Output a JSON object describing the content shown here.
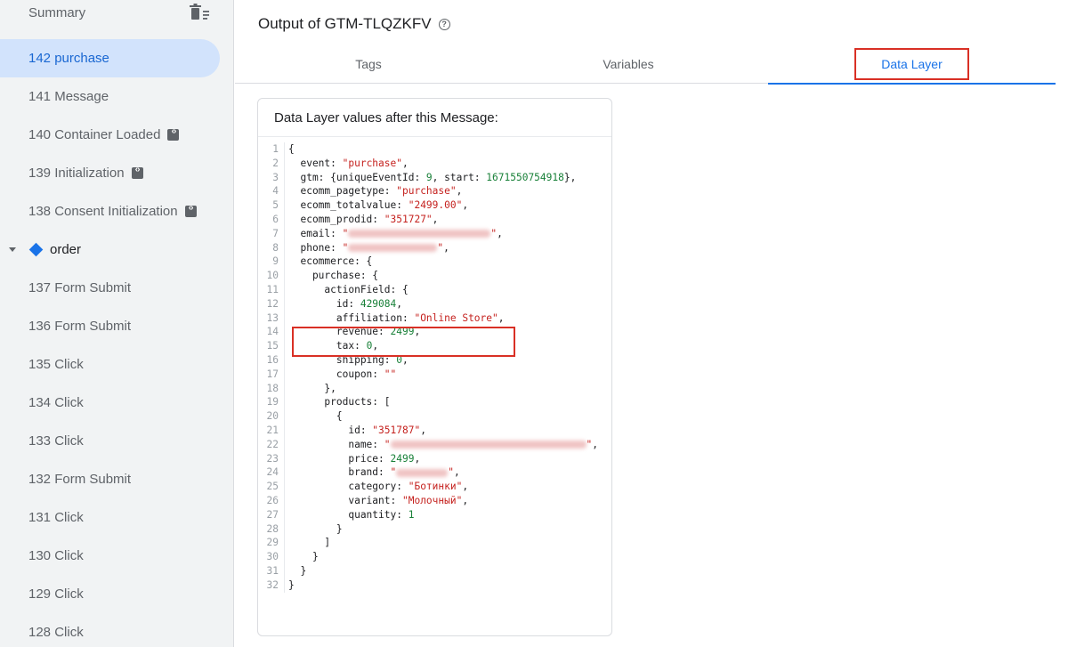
{
  "sidebar": {
    "summary_label": "Summary",
    "items": [
      {
        "label": "142 purchase",
        "selected": true,
        "code": false
      },
      {
        "label": "141 Message",
        "selected": false,
        "code": false
      },
      {
        "label": "140 Container Loaded",
        "selected": false,
        "code": true
      },
      {
        "label": "139 Initialization",
        "selected": false,
        "code": true
      },
      {
        "label": "138 Consent Initialization",
        "selected": false,
        "code": true
      }
    ],
    "group": {
      "label": "order"
    },
    "group_items": [
      {
        "label": "137 Form Submit"
      },
      {
        "label": "136 Form Submit"
      },
      {
        "label": "135 Click"
      },
      {
        "label": "134 Click"
      },
      {
        "label": "133 Click"
      },
      {
        "label": "132 Form Submit"
      },
      {
        "label": "131 Click"
      },
      {
        "label": "130 Click"
      },
      {
        "label": "129 Click"
      },
      {
        "label": "128 Click"
      }
    ]
  },
  "main": {
    "title": "Output of GTM-TLQZKFV",
    "tabs": [
      {
        "label": "Tags",
        "active": false
      },
      {
        "label": "Variables",
        "active": false
      },
      {
        "label": "Data Layer",
        "active": true
      }
    ],
    "card_title": "Data Layer values after this Message:"
  },
  "code_lines": [
    {
      "n": "1",
      "text": "{"
    },
    {
      "n": "2",
      "text": "  event: \"purchase\","
    },
    {
      "n": "3",
      "text": "  gtm: {uniqueEventId: 9, start: 1671550754918},"
    },
    {
      "n": "4",
      "text": "  ecomm_pagetype: \"purchase\","
    },
    {
      "n": "5",
      "text": "  ecomm_totalvalue: \"2499.00\","
    },
    {
      "n": "6",
      "text": "  ecomm_prodid: \"351727\","
    },
    {
      "n": "7",
      "text": "  email: \"\","
    },
    {
      "n": "8",
      "text": "  phone: \"\","
    },
    {
      "n": "9",
      "text": "  ecommerce: {"
    },
    {
      "n": "10",
      "text": "    purchase: {"
    },
    {
      "n": "11",
      "text": "      actionField: {"
    },
    {
      "n": "12",
      "text": "        id: 429084,"
    },
    {
      "n": "13",
      "text": "        affiliation: \"Online Store\","
    },
    {
      "n": "14",
      "text": "        revenue: 2499,"
    },
    {
      "n": "15",
      "text": "        tax: 0,"
    },
    {
      "n": "16",
      "text": "        shipping: 0,"
    },
    {
      "n": "17",
      "text": "        coupon: \"\""
    },
    {
      "n": "18",
      "text": "      },"
    },
    {
      "n": "19",
      "text": "      products: ["
    },
    {
      "n": "20",
      "text": "        {"
    },
    {
      "n": "21",
      "text": "          id: \"351787\","
    },
    {
      "n": "22",
      "text": "          name: \"\","
    },
    {
      "n": "23",
      "text": "          price: 2499,"
    },
    {
      "n": "24",
      "text": "          brand: \"\","
    },
    {
      "n": "25",
      "text": "          category: \"Ботинки\","
    },
    {
      "n": "26",
      "text": "          variant: \"Молочный\","
    },
    {
      "n": "27",
      "text": "          quantity: 1"
    },
    {
      "n": "28",
      "text": "        }"
    },
    {
      "n": "29",
      "text": "      ]"
    },
    {
      "n": "30",
      "text": "    }"
    },
    {
      "n": "31",
      "text": "  }"
    },
    {
      "n": "32",
      "text": "}"
    }
  ],
  "colors": {
    "accent": "#1a73e8",
    "highlight": "#d93025",
    "string": "#c5221f",
    "number": "#188038"
  }
}
